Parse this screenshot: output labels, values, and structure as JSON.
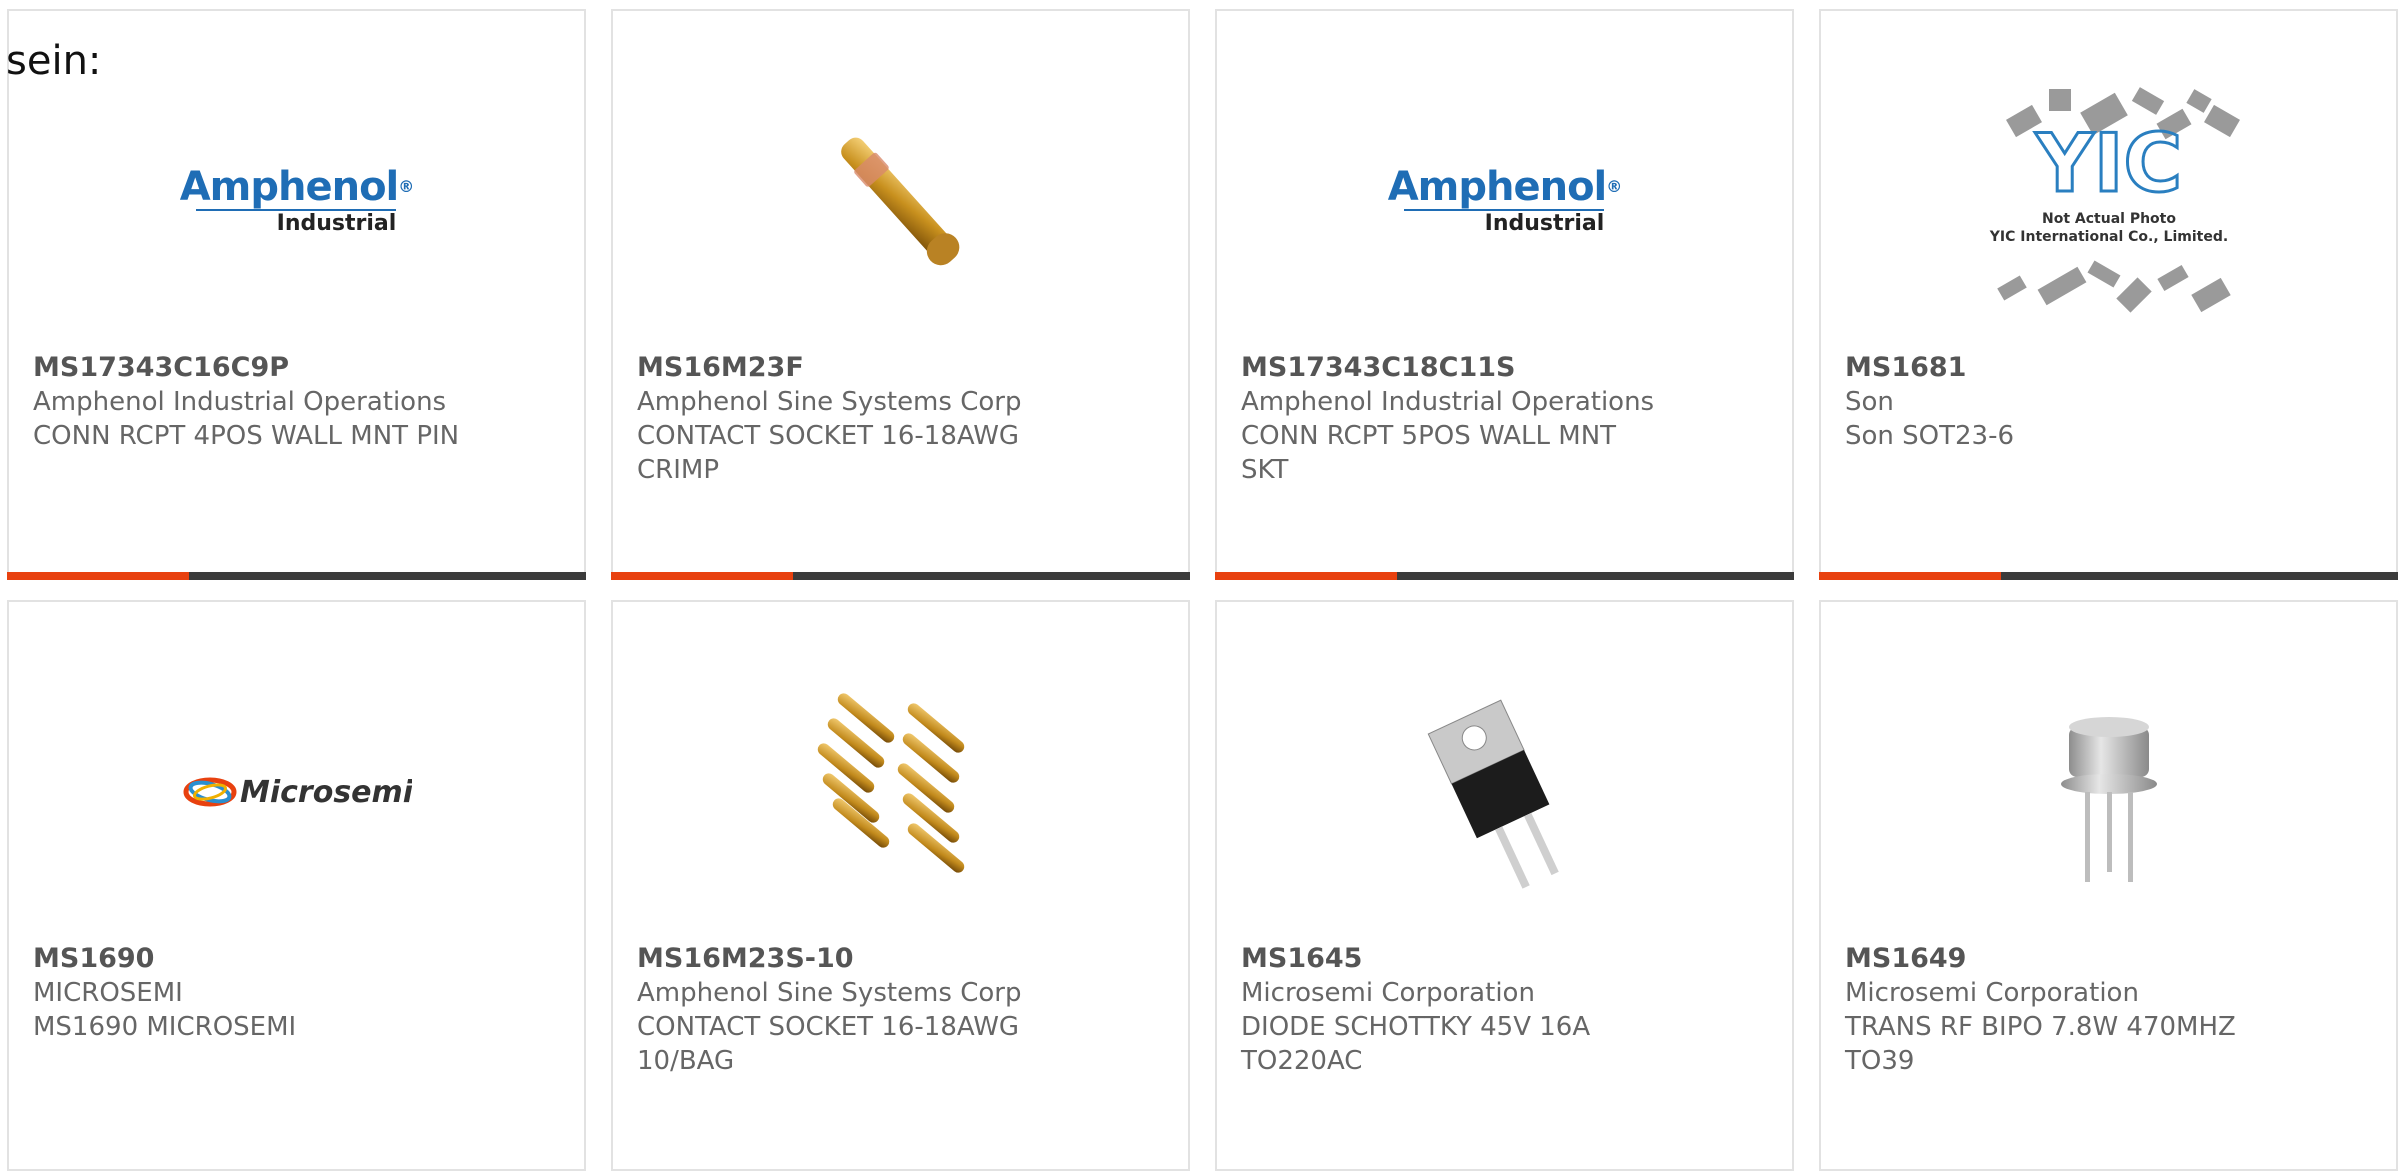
{
  "intro_text": "sein:",
  "colors": {
    "accent": "#e8410f",
    "bar": "#3b3b3b",
    "border": "#e2e2e2",
    "amphenol_blue": "#1f6db5"
  },
  "products": [
    {
      "part": "MS17343C16C9P",
      "manufacturer": "Amphenol Industrial Operations",
      "description": "CONN RCPT 4POS WALL MNT PIN",
      "image": "amphenol-logo",
      "logo_main": "Amphenol",
      "logo_sub": "Industrial"
    },
    {
      "part": "MS16M23F",
      "manufacturer": "Amphenol Sine Systems Corp",
      "description": "CONTACT SOCKET 16-18AWG CRIMP",
      "image": "gold-contact-photo"
    },
    {
      "part": "MS17343C18C11S",
      "manufacturer": "Amphenol Industrial Operations",
      "description": "CONN RCPT 5POS WALL MNT SKT",
      "image": "amphenol-logo",
      "logo_main": "Amphenol",
      "logo_sub": "Industrial"
    },
    {
      "part": "MS1681",
      "manufacturer": "Son",
      "description": "Son SOT23-6",
      "image": "yic-placeholder",
      "logo_line1": "Not Actual Photo",
      "logo_line2": "YIC International Co., Limited."
    },
    {
      "part": "MS1690",
      "manufacturer": "MICROSEMI",
      "description": "MS1690 MICROSEMI",
      "image": "microsemi-logo",
      "logo_main": "Microsemi"
    },
    {
      "part": "MS16M23S-10",
      "manufacturer": "Amphenol Sine Systems Corp",
      "description": "CONTACT SOCKET 16-18AWG 10/BAG",
      "image": "gold-contacts-bag-photo"
    },
    {
      "part": "MS1645",
      "manufacturer": "Microsemi Corporation",
      "description": "DIODE SCHOTTKY 45V 16A TO220AC",
      "image": "to220-diode-photo"
    },
    {
      "part": "MS1649",
      "manufacturer": "Microsemi Corporation",
      "description": "TRANS RF BIPO 7.8W 470MHZ TO39",
      "image": "to39-transistor-photo"
    }
  ]
}
